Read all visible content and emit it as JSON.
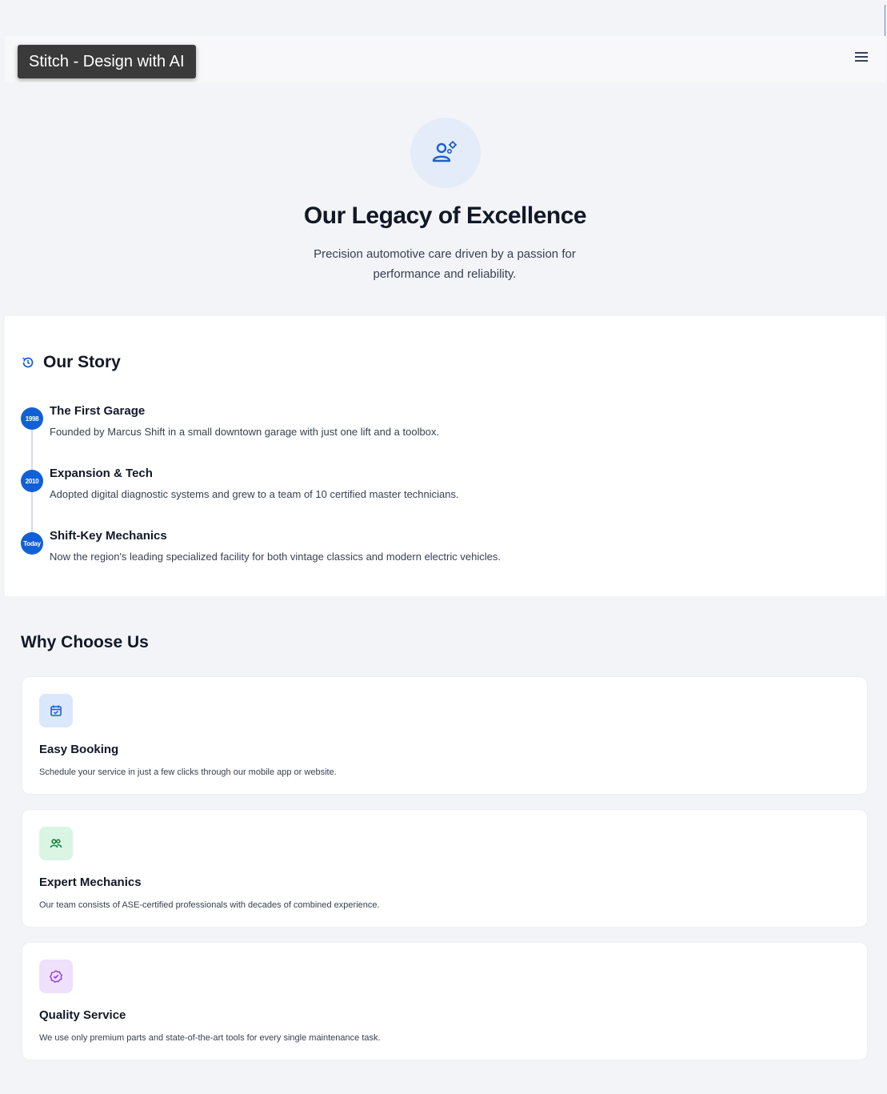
{
  "tooltip": {
    "text": "Stitch - Design with AI"
  },
  "header": {
    "menu_icon": "menu-icon"
  },
  "hero": {
    "icon": "engineer-icon",
    "title": "Our Legacy of Excellence",
    "subtitle": "Precision automotive care driven by a passion for performance and reliability."
  },
  "story": {
    "icon": "history-icon",
    "title": "Our Story",
    "items": [
      {
        "badge": "1998",
        "title": "The First Garage",
        "desc": "Founded by Marcus Shift in a small downtown garage with just one lift and a toolbox."
      },
      {
        "badge": "2010",
        "title": "Expansion & Tech",
        "desc": "Adopted digital diagnostic systems and grew to a team of 10 certified master technicians."
      },
      {
        "badge": "Today",
        "title": "Shift-Key Mechanics",
        "desc": "Now the region's leading specialized facility for both vintage classics and modern electric vehicles."
      }
    ]
  },
  "why": {
    "title": "Why Choose Us",
    "cards": [
      {
        "icon": "calendar-check-icon",
        "title": "Easy Booking",
        "desc": "Schedule your service in just a few clicks through our mobile app or website.",
        "icon_bg": "#dbe7fb",
        "icon_color": "#1d5fd1"
      },
      {
        "icon": "team-icon",
        "title": "Expert Mechanics",
        "desc": "Our team consists of ASE-certified professionals with decades of combined experience.",
        "icon_bg": "#d9f5e3",
        "icon_color": "#15803d"
      },
      {
        "icon": "verified-icon",
        "title": "Quality Service",
        "desc": "We use only premium parts and state-of-the-art tools for every single maintenance task.",
        "icon_bg": "#efe0fb",
        "icon_color": "#8b3fd9"
      }
    ]
  },
  "colors": {
    "accent": "#1160d8",
    "background": "#f3f4f8",
    "surface": "#ffffff"
  }
}
